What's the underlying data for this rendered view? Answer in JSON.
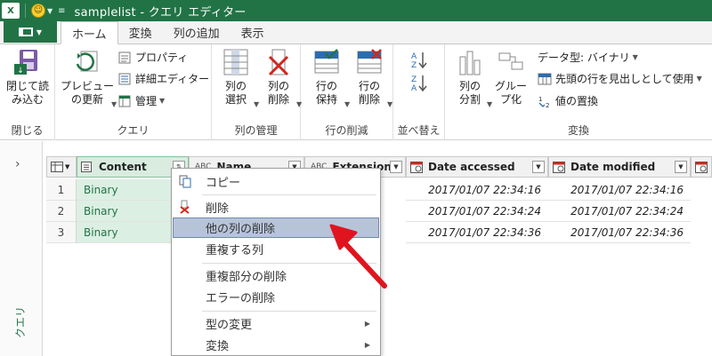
{
  "titlebar": {
    "app_icon": "X",
    "smiley_icon": "smiley-icon",
    "title": "samplelist - クエリ エディター"
  },
  "tabs": {
    "home": "ホーム",
    "transform": "変換",
    "add_column": "列の追加",
    "view": "表示"
  },
  "ribbon": {
    "close": {
      "button": "閉じて読\nみ込む",
      "label": "閉じる"
    },
    "query": {
      "preview": "プレビュー\nの更新",
      "properties": "プロパティ",
      "advanced_editor": "詳細エディター",
      "manage": "管理",
      "label": "クエリ"
    },
    "columns": {
      "select": "列の\n選択",
      "remove": "列の\n削除",
      "label": "列の管理"
    },
    "rows": {
      "keep": "行の\n保持",
      "remove": "行の\n削除",
      "label": "行の削減"
    },
    "sort": {
      "label": "並べ替え"
    },
    "transform": {
      "split": "列の\n分割",
      "group": "グルー\nプ化",
      "datatype": "データ型: バイナリ",
      "first_row_header": "先頭の行を見出しとして使用",
      "replace": "値の置換",
      "label": "変換"
    }
  },
  "side": {
    "label": "クエリ"
  },
  "grid": {
    "headers": {
      "content": "Content",
      "name": "Name",
      "extension": "Extension",
      "date_accessed": "Date accessed",
      "date_modified": "Date modified"
    },
    "rows": [
      {
        "num": "1",
        "content": "Binary",
        "accessed": "2017/01/07 22:34:16",
        "modified": "2017/01/07 22:34:16"
      },
      {
        "num": "2",
        "content": "Binary",
        "accessed": "2017/01/07 22:34:24",
        "modified": "2017/01/07 22:34:24"
      },
      {
        "num": "3",
        "content": "Binary",
        "accessed": "2017/01/07 22:34:36",
        "modified": "2017/01/07 22:34:36"
      }
    ]
  },
  "context_menu": {
    "copy": "コピー",
    "delete": "削除",
    "remove_other": "他の列の削除",
    "duplicate": "重複する列",
    "remove_duplicates": "重複部分の削除",
    "remove_errors": "エラーの削除",
    "change_type": "型の変更",
    "transform": "変換"
  },
  "colors": {
    "accent": "#217346",
    "highlight": "#b7c4d8",
    "arrow": "#e0141e"
  }
}
